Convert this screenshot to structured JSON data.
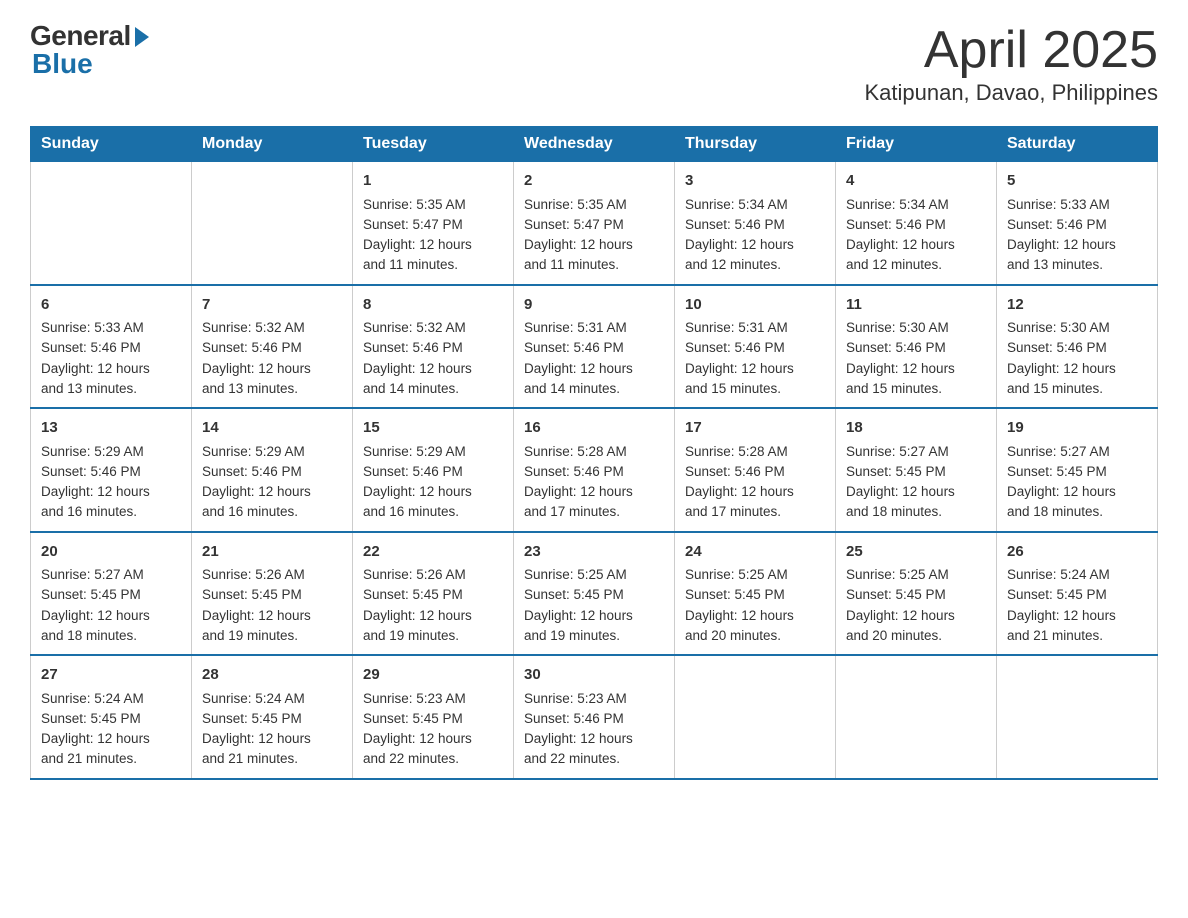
{
  "logo": {
    "general": "General",
    "blue": "Blue"
  },
  "title": "April 2025",
  "subtitle": "Katipunan, Davao, Philippines",
  "days_of_week": [
    "Sunday",
    "Monday",
    "Tuesday",
    "Wednesday",
    "Thursday",
    "Friday",
    "Saturday"
  ],
  "weeks": [
    [
      {
        "day": "",
        "info": ""
      },
      {
        "day": "",
        "info": ""
      },
      {
        "day": "1",
        "info": "Sunrise: 5:35 AM\nSunset: 5:47 PM\nDaylight: 12 hours\nand 11 minutes."
      },
      {
        "day": "2",
        "info": "Sunrise: 5:35 AM\nSunset: 5:47 PM\nDaylight: 12 hours\nand 11 minutes."
      },
      {
        "day": "3",
        "info": "Sunrise: 5:34 AM\nSunset: 5:46 PM\nDaylight: 12 hours\nand 12 minutes."
      },
      {
        "day": "4",
        "info": "Sunrise: 5:34 AM\nSunset: 5:46 PM\nDaylight: 12 hours\nand 12 minutes."
      },
      {
        "day": "5",
        "info": "Sunrise: 5:33 AM\nSunset: 5:46 PM\nDaylight: 12 hours\nand 13 minutes."
      }
    ],
    [
      {
        "day": "6",
        "info": "Sunrise: 5:33 AM\nSunset: 5:46 PM\nDaylight: 12 hours\nand 13 minutes."
      },
      {
        "day": "7",
        "info": "Sunrise: 5:32 AM\nSunset: 5:46 PM\nDaylight: 12 hours\nand 13 minutes."
      },
      {
        "day": "8",
        "info": "Sunrise: 5:32 AM\nSunset: 5:46 PM\nDaylight: 12 hours\nand 14 minutes."
      },
      {
        "day": "9",
        "info": "Sunrise: 5:31 AM\nSunset: 5:46 PM\nDaylight: 12 hours\nand 14 minutes."
      },
      {
        "day": "10",
        "info": "Sunrise: 5:31 AM\nSunset: 5:46 PM\nDaylight: 12 hours\nand 15 minutes."
      },
      {
        "day": "11",
        "info": "Sunrise: 5:30 AM\nSunset: 5:46 PM\nDaylight: 12 hours\nand 15 minutes."
      },
      {
        "day": "12",
        "info": "Sunrise: 5:30 AM\nSunset: 5:46 PM\nDaylight: 12 hours\nand 15 minutes."
      }
    ],
    [
      {
        "day": "13",
        "info": "Sunrise: 5:29 AM\nSunset: 5:46 PM\nDaylight: 12 hours\nand 16 minutes."
      },
      {
        "day": "14",
        "info": "Sunrise: 5:29 AM\nSunset: 5:46 PM\nDaylight: 12 hours\nand 16 minutes."
      },
      {
        "day": "15",
        "info": "Sunrise: 5:29 AM\nSunset: 5:46 PM\nDaylight: 12 hours\nand 16 minutes."
      },
      {
        "day": "16",
        "info": "Sunrise: 5:28 AM\nSunset: 5:46 PM\nDaylight: 12 hours\nand 17 minutes."
      },
      {
        "day": "17",
        "info": "Sunrise: 5:28 AM\nSunset: 5:46 PM\nDaylight: 12 hours\nand 17 minutes."
      },
      {
        "day": "18",
        "info": "Sunrise: 5:27 AM\nSunset: 5:45 PM\nDaylight: 12 hours\nand 18 minutes."
      },
      {
        "day": "19",
        "info": "Sunrise: 5:27 AM\nSunset: 5:45 PM\nDaylight: 12 hours\nand 18 minutes."
      }
    ],
    [
      {
        "day": "20",
        "info": "Sunrise: 5:27 AM\nSunset: 5:45 PM\nDaylight: 12 hours\nand 18 minutes."
      },
      {
        "day": "21",
        "info": "Sunrise: 5:26 AM\nSunset: 5:45 PM\nDaylight: 12 hours\nand 19 minutes."
      },
      {
        "day": "22",
        "info": "Sunrise: 5:26 AM\nSunset: 5:45 PM\nDaylight: 12 hours\nand 19 minutes."
      },
      {
        "day": "23",
        "info": "Sunrise: 5:25 AM\nSunset: 5:45 PM\nDaylight: 12 hours\nand 19 minutes."
      },
      {
        "day": "24",
        "info": "Sunrise: 5:25 AM\nSunset: 5:45 PM\nDaylight: 12 hours\nand 20 minutes."
      },
      {
        "day": "25",
        "info": "Sunrise: 5:25 AM\nSunset: 5:45 PM\nDaylight: 12 hours\nand 20 minutes."
      },
      {
        "day": "26",
        "info": "Sunrise: 5:24 AM\nSunset: 5:45 PM\nDaylight: 12 hours\nand 21 minutes."
      }
    ],
    [
      {
        "day": "27",
        "info": "Sunrise: 5:24 AM\nSunset: 5:45 PM\nDaylight: 12 hours\nand 21 minutes."
      },
      {
        "day": "28",
        "info": "Sunrise: 5:24 AM\nSunset: 5:45 PM\nDaylight: 12 hours\nand 21 minutes."
      },
      {
        "day": "29",
        "info": "Sunrise: 5:23 AM\nSunset: 5:45 PM\nDaylight: 12 hours\nand 22 minutes."
      },
      {
        "day": "30",
        "info": "Sunrise: 5:23 AM\nSunset: 5:46 PM\nDaylight: 12 hours\nand 22 minutes."
      },
      {
        "day": "",
        "info": ""
      },
      {
        "day": "",
        "info": ""
      },
      {
        "day": "",
        "info": ""
      }
    ]
  ]
}
